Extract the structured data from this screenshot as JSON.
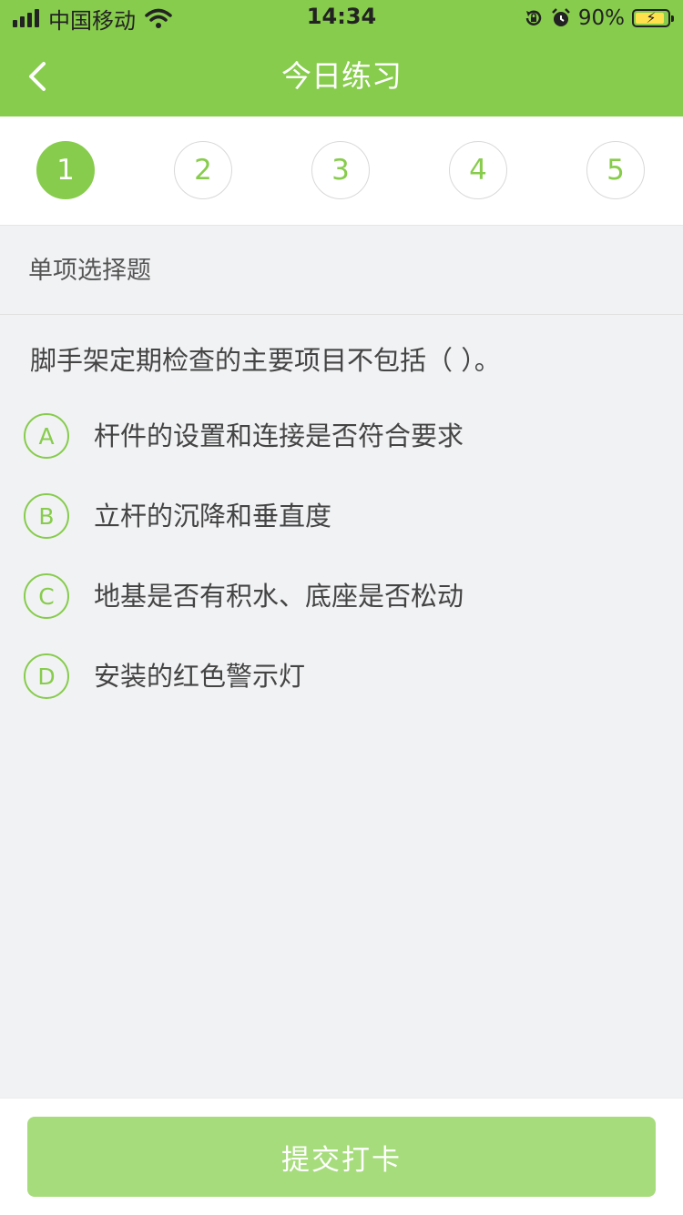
{
  "status_bar": {
    "carrier": "中国移动",
    "time": "14:34",
    "battery_percent": "90%",
    "battery_level": 0.9,
    "icons": [
      "signal-icon",
      "wifi-icon",
      "rotation-lock-icon",
      "alarm-icon",
      "battery-charging-icon"
    ]
  },
  "header": {
    "title": "今日练习",
    "back_icon": "chevron-left-icon",
    "bg_color": "#87cc4c"
  },
  "steps": {
    "items": [
      "1",
      "2",
      "3",
      "4",
      "5"
    ],
    "active_index": 0
  },
  "question": {
    "type": "单项选择题",
    "stem": "脚手架定期检查的主要项目不包括（    ）。",
    "options": [
      {
        "letter": "A",
        "text": "杆件的设置和连接是否符合要求"
      },
      {
        "letter": "B",
        "text": "立杆的沉降和垂直度"
      },
      {
        "letter": "C",
        "text": "地基是否有积水、底座是否松动"
      },
      {
        "letter": "D",
        "text": "安装的红色警示灯"
      }
    ]
  },
  "footer": {
    "submit_label": "提交打卡"
  },
  "colors": {
    "accent": "#87cc4c",
    "button_disabled": "#a7dc7c",
    "background": "#f1f2f4"
  }
}
